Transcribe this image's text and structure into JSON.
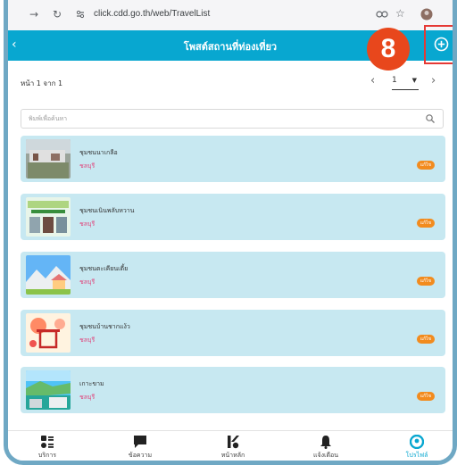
{
  "browser": {
    "url": "click.cdd.go.th/web/TravelList"
  },
  "header": {
    "title": "โพสต์สถานที่ท่องเที่ยว"
  },
  "annotation": {
    "step": "8"
  },
  "pager": {
    "info": "หน้า 1 จาก 1",
    "current": "1"
  },
  "search": {
    "placeholder": "พิมพ์เพื่อค้นหา"
  },
  "places": [
    {
      "name": "ชุมชนนาเกลือ",
      "province": "ชลบุรี",
      "edit": "แก้ไข"
    },
    {
      "name": "ชุมชนเนินพลับหวาน",
      "province": "ชลบุรี",
      "edit": "แก้ไข"
    },
    {
      "name": "ชุมชนตะเคียนเตี้ย",
      "province": "ชลบุรี",
      "edit": "แก้ไข"
    },
    {
      "name": "ชุมชนบ้านชากแง้ว",
      "province": "ชลบุรี",
      "edit": "แก้ไข"
    },
    {
      "name": "เกาะขาม",
      "province": "ชลบุรี",
      "edit": "แก้ไข"
    }
  ],
  "bottom_nav": [
    {
      "label": "บริการ",
      "icon": "services-icon"
    },
    {
      "label": "ข้อความ",
      "icon": "message-icon"
    },
    {
      "label": "หน้าหลัก",
      "icon": "home-logo-icon"
    },
    {
      "label": "แจ้งเตือน",
      "icon": "bell-icon"
    },
    {
      "label": "โปรไฟล์",
      "icon": "profile-icon",
      "active": true
    }
  ],
  "colors": {
    "header": "#08a7d0",
    "card": "#c7e8f1",
    "badge": "#e8471c",
    "highlight": "#e53935",
    "edit": "#f28b1e",
    "province": "#e0437a"
  }
}
